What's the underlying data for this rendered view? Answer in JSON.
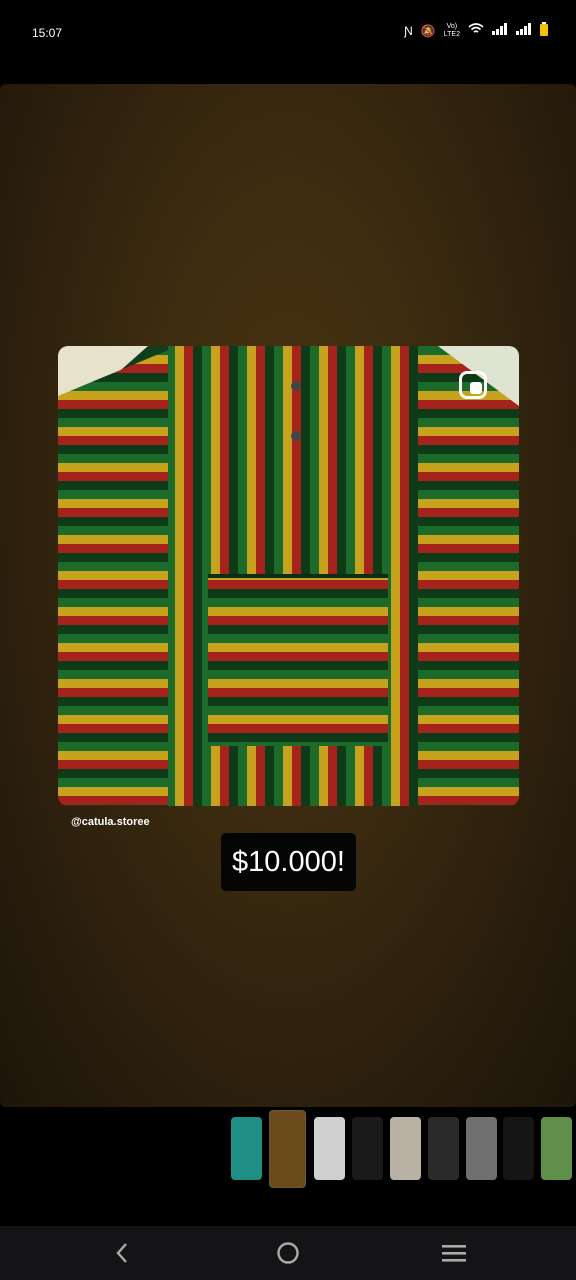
{
  "status_bar": {
    "time": "15:07",
    "icons": [
      "nfc-icon",
      "mute-icon",
      "volte-icon",
      "wifi-icon",
      "signal-icon",
      "signal-icon",
      "battery-icon"
    ],
    "volte_label": "LTE2"
  },
  "story": {
    "handle": "@catula.storee",
    "price": "$10.000!"
  },
  "thumbnails": {
    "count": 9,
    "active_index": 1,
    "colors": [
      "#1f8f86",
      "#6b4a1c",
      "#cfcfcf",
      "#1a1a1a",
      "#b9b1a4",
      "#2a2a2a",
      "#6f6f6f",
      "#151515",
      "#5f8f4a"
    ]
  },
  "nav_bar": {
    "back": "back-icon",
    "home": "home-icon",
    "menu": "menu-icon"
  }
}
